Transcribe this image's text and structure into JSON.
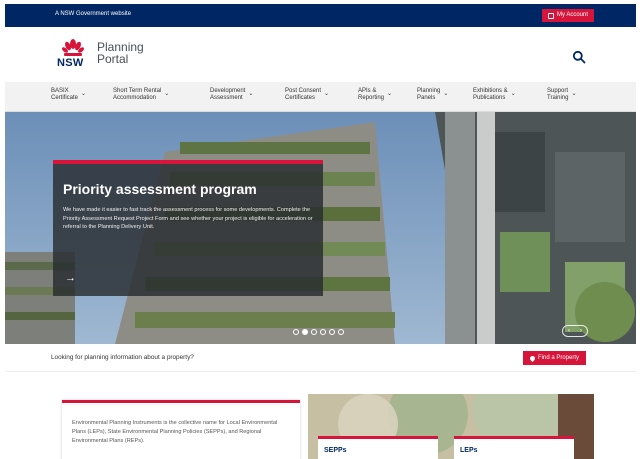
{
  "gov_bar": {
    "text": "A NSW Government website",
    "account_label": "My Account"
  },
  "header": {
    "logo_text": "NSW",
    "brand_line1": "Planning",
    "brand_line2": "Portal",
    "search_icon": "search-icon"
  },
  "nav": {
    "items": [
      {
        "line1": "BASIX",
        "line2": "Certificate"
      },
      {
        "line1": "Short Term Rental",
        "line2": "Accommodation"
      },
      {
        "line1": "Development",
        "line2": "Assessment"
      },
      {
        "line1": "Post Consent",
        "line2": "Certificates"
      },
      {
        "line1": "APIs &",
        "line2": "Reporting"
      },
      {
        "line1": "Planning",
        "line2": "Panels"
      },
      {
        "line1": "Exhibitions &",
        "line2": "Publications"
      },
      {
        "line1": "Support",
        "line2": "Training"
      }
    ]
  },
  "hero": {
    "title": "Priority assessment program",
    "description": "We have made it easier to fast track the assessment process for some developments. Complete the Priority Assessment Request Project Form and see whether your project is eligible for acceleration or referral to the Planning Delivery Unit.",
    "arrow": "→",
    "prev": "‹",
    "next": "›",
    "slide_count": 6,
    "active_slide": 1
  },
  "property": {
    "prompt": "Looking for planning information about a property?",
    "button_label": "Find a Property"
  },
  "lower": {
    "info_text": "Environmental Planning Instruments is the collective name for Local Environmental Plans (LEPs), State Environmental Planning Policies (SEPPs), and Regional Environmental Plans (REPs).",
    "tile_left": "SEPPs",
    "tile_right": "LEPs"
  },
  "colors": {
    "navy": "#002664",
    "red": "#d7153a",
    "nav_bg": "#f2f2f2"
  }
}
